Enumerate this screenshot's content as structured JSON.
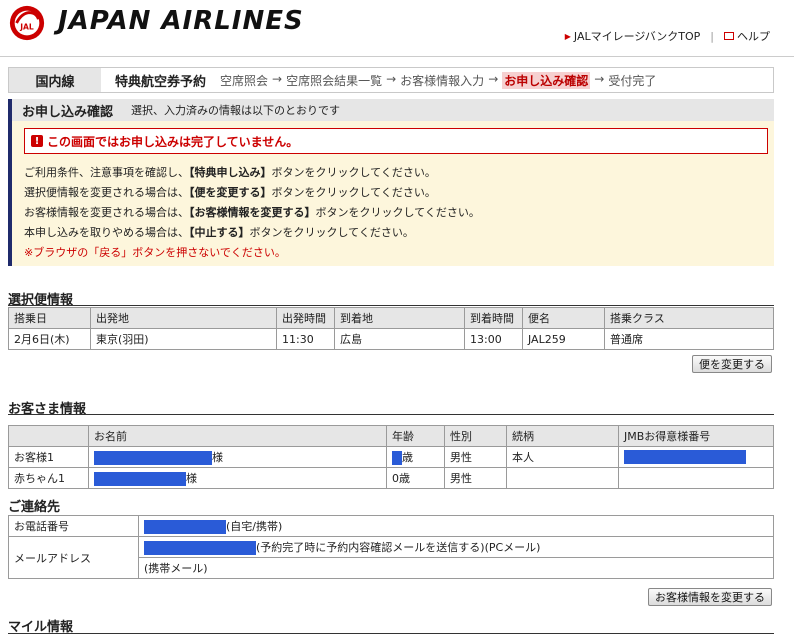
{
  "header": {
    "brand": "JAPAN AIRLINES",
    "logo_text": "JAL",
    "link_mileage": "JALマイレージバンクTOP",
    "link_help": "ヘルプ"
  },
  "stepbar": {
    "category": "国内線",
    "product": "特典航空券予約",
    "steps": [
      "空席照会",
      "→",
      "空席照会結果一覧",
      "→",
      "お客様情報入力",
      "→",
      "お申し込み確認",
      "→",
      "受付完了"
    ],
    "current_index": 6
  },
  "confirm": {
    "title": "お申し込み確認",
    "subtitle": "選択、入力済みの情報は以下のとおりです",
    "alert": "この画面ではお申し込みは完了していません。",
    "lines": [
      {
        "pre": "ご利用条件、注意事項を確認し、",
        "btn": "【特典申し込み】",
        "post": "ボタンをクリックしてください。"
      },
      {
        "pre": "選択便情報を変更される場合は、",
        "btn": "【便を変更する】",
        "post": "ボタンをクリックしてください。"
      },
      {
        "pre": "お客様情報を変更される場合は、",
        "btn": "【お客様情報を変更する】",
        "post": "ボタンをクリックしてください。"
      },
      {
        "pre": "本申し込みを取りやめる場合は、",
        "btn": "【中止する】",
        "post": "ボタンをクリックしてください。"
      }
    ],
    "warning": "※ブラウザの「戻る」ボタンを押さないでください。"
  },
  "flight": {
    "title": "選択便情報",
    "headers": [
      "搭乗日",
      "出発地",
      "出発時間",
      "到着地",
      "到着時間",
      "便名",
      "搭乗クラス"
    ],
    "row": [
      "2月6日(木)",
      "東京(羽田)",
      "11:30",
      "広島",
      "13:00",
      "JAL259",
      "普通席"
    ],
    "change_button": "便を変更する"
  },
  "passengers": {
    "title": "お客さま情報",
    "headers": [
      "",
      "お名前",
      "年齢",
      "性別",
      "続柄",
      "JMBお得意様番号"
    ],
    "rows": [
      {
        "label": "お客様1",
        "suffix": "様",
        "age": "歳",
        "sex": "男性",
        "relation": "本人"
      },
      {
        "label": "赤ちゃん1",
        "suffix": "様",
        "age": "0歳",
        "sex": "男性",
        "relation": ""
      }
    ]
  },
  "contact": {
    "title": "ご連絡先",
    "phone_label": "お電話番号",
    "phone_suffix": "(自宅/携帯)",
    "mail_label": "メールアドレス",
    "mail_suffix": "(予約完了時に予約内容確認メールを送信する)(PCメール)",
    "mobile_mail": "(携帯メール)",
    "change_button": "お客様情報を変更する"
  },
  "mile": {
    "title": "マイル情報"
  },
  "colors": {
    "brand_red": "#cc0000",
    "accent_navy": "#1f2a6b",
    "redaction_blue": "#2a5bd7",
    "notice_bg": "#fdf6dc"
  }
}
